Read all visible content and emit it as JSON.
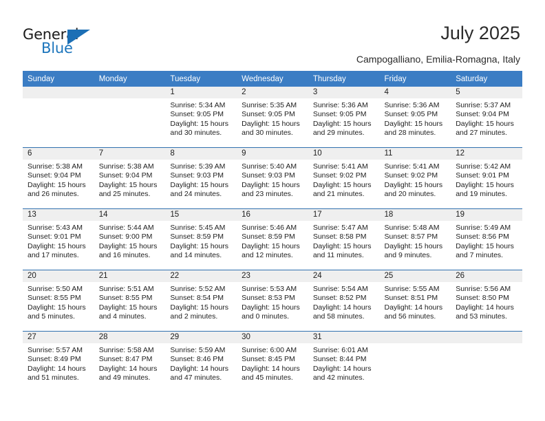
{
  "logo": {
    "word_general": "General",
    "word_blue": "Blue",
    "brand_color": "#1c75bc"
  },
  "header": {
    "title": "July 2025",
    "subtitle": "Campogalliano, Emilia-Romagna, Italy",
    "header_bg": "#3b7dc4",
    "daynum_bg": "#efefef"
  },
  "calendar": {
    "weekday_headers": [
      "Sunday",
      "Monday",
      "Tuesday",
      "Wednesday",
      "Thursday",
      "Friday",
      "Saturday"
    ],
    "weeks": [
      [
        {
          "day": "",
          "lines": []
        },
        {
          "day": "",
          "lines": []
        },
        {
          "day": "1",
          "lines": [
            "Sunrise: 5:34 AM",
            "Sunset: 9:05 PM",
            "Daylight: 15 hours",
            "and 30 minutes."
          ]
        },
        {
          "day": "2",
          "lines": [
            "Sunrise: 5:35 AM",
            "Sunset: 9:05 PM",
            "Daylight: 15 hours",
            "and 30 minutes."
          ]
        },
        {
          "day": "3",
          "lines": [
            "Sunrise: 5:36 AM",
            "Sunset: 9:05 PM",
            "Daylight: 15 hours",
            "and 29 minutes."
          ]
        },
        {
          "day": "4",
          "lines": [
            "Sunrise: 5:36 AM",
            "Sunset: 9:05 PM",
            "Daylight: 15 hours",
            "and 28 minutes."
          ]
        },
        {
          "day": "5",
          "lines": [
            "Sunrise: 5:37 AM",
            "Sunset: 9:04 PM",
            "Daylight: 15 hours",
            "and 27 minutes."
          ]
        }
      ],
      [
        {
          "day": "6",
          "lines": [
            "Sunrise: 5:38 AM",
            "Sunset: 9:04 PM",
            "Daylight: 15 hours",
            "and 26 minutes."
          ]
        },
        {
          "day": "7",
          "lines": [
            "Sunrise: 5:38 AM",
            "Sunset: 9:04 PM",
            "Daylight: 15 hours",
            "and 25 minutes."
          ]
        },
        {
          "day": "8",
          "lines": [
            "Sunrise: 5:39 AM",
            "Sunset: 9:03 PM",
            "Daylight: 15 hours",
            "and 24 minutes."
          ]
        },
        {
          "day": "9",
          "lines": [
            "Sunrise: 5:40 AM",
            "Sunset: 9:03 PM",
            "Daylight: 15 hours",
            "and 23 minutes."
          ]
        },
        {
          "day": "10",
          "lines": [
            "Sunrise: 5:41 AM",
            "Sunset: 9:02 PM",
            "Daylight: 15 hours",
            "and 21 minutes."
          ]
        },
        {
          "day": "11",
          "lines": [
            "Sunrise: 5:41 AM",
            "Sunset: 9:02 PM",
            "Daylight: 15 hours",
            "and 20 minutes."
          ]
        },
        {
          "day": "12",
          "lines": [
            "Sunrise: 5:42 AM",
            "Sunset: 9:01 PM",
            "Daylight: 15 hours",
            "and 19 minutes."
          ]
        }
      ],
      [
        {
          "day": "13",
          "lines": [
            "Sunrise: 5:43 AM",
            "Sunset: 9:01 PM",
            "Daylight: 15 hours",
            "and 17 minutes."
          ]
        },
        {
          "day": "14",
          "lines": [
            "Sunrise: 5:44 AM",
            "Sunset: 9:00 PM",
            "Daylight: 15 hours",
            "and 16 minutes."
          ]
        },
        {
          "day": "15",
          "lines": [
            "Sunrise: 5:45 AM",
            "Sunset: 8:59 PM",
            "Daylight: 15 hours",
            "and 14 minutes."
          ]
        },
        {
          "day": "16",
          "lines": [
            "Sunrise: 5:46 AM",
            "Sunset: 8:59 PM",
            "Daylight: 15 hours",
            "and 12 minutes."
          ]
        },
        {
          "day": "17",
          "lines": [
            "Sunrise: 5:47 AM",
            "Sunset: 8:58 PM",
            "Daylight: 15 hours",
            "and 11 minutes."
          ]
        },
        {
          "day": "18",
          "lines": [
            "Sunrise: 5:48 AM",
            "Sunset: 8:57 PM",
            "Daylight: 15 hours",
            "and 9 minutes."
          ]
        },
        {
          "day": "19",
          "lines": [
            "Sunrise: 5:49 AM",
            "Sunset: 8:56 PM",
            "Daylight: 15 hours",
            "and 7 minutes."
          ]
        }
      ],
      [
        {
          "day": "20",
          "lines": [
            "Sunrise: 5:50 AM",
            "Sunset: 8:55 PM",
            "Daylight: 15 hours",
            "and 5 minutes."
          ]
        },
        {
          "day": "21",
          "lines": [
            "Sunrise: 5:51 AM",
            "Sunset: 8:55 PM",
            "Daylight: 15 hours",
            "and 4 minutes."
          ]
        },
        {
          "day": "22",
          "lines": [
            "Sunrise: 5:52 AM",
            "Sunset: 8:54 PM",
            "Daylight: 15 hours",
            "and 2 minutes."
          ]
        },
        {
          "day": "23",
          "lines": [
            "Sunrise: 5:53 AM",
            "Sunset: 8:53 PM",
            "Daylight: 15 hours",
            "and 0 minutes."
          ]
        },
        {
          "day": "24",
          "lines": [
            "Sunrise: 5:54 AM",
            "Sunset: 8:52 PM",
            "Daylight: 14 hours",
            "and 58 minutes."
          ]
        },
        {
          "day": "25",
          "lines": [
            "Sunrise: 5:55 AM",
            "Sunset: 8:51 PM",
            "Daylight: 14 hours",
            "and 56 minutes."
          ]
        },
        {
          "day": "26",
          "lines": [
            "Sunrise: 5:56 AM",
            "Sunset: 8:50 PM",
            "Daylight: 14 hours",
            "and 53 minutes."
          ]
        }
      ],
      [
        {
          "day": "27",
          "lines": [
            "Sunrise: 5:57 AM",
            "Sunset: 8:49 PM",
            "Daylight: 14 hours",
            "and 51 minutes."
          ]
        },
        {
          "day": "28",
          "lines": [
            "Sunrise: 5:58 AM",
            "Sunset: 8:47 PM",
            "Daylight: 14 hours",
            "and 49 minutes."
          ]
        },
        {
          "day": "29",
          "lines": [
            "Sunrise: 5:59 AM",
            "Sunset: 8:46 PM",
            "Daylight: 14 hours",
            "and 47 minutes."
          ]
        },
        {
          "day": "30",
          "lines": [
            "Sunrise: 6:00 AM",
            "Sunset: 8:45 PM",
            "Daylight: 14 hours",
            "and 45 minutes."
          ]
        },
        {
          "day": "31",
          "lines": [
            "Sunrise: 6:01 AM",
            "Sunset: 8:44 PM",
            "Daylight: 14 hours",
            "and 42 minutes."
          ]
        },
        {
          "day": "",
          "lines": []
        },
        {
          "day": "",
          "lines": []
        }
      ]
    ]
  }
}
